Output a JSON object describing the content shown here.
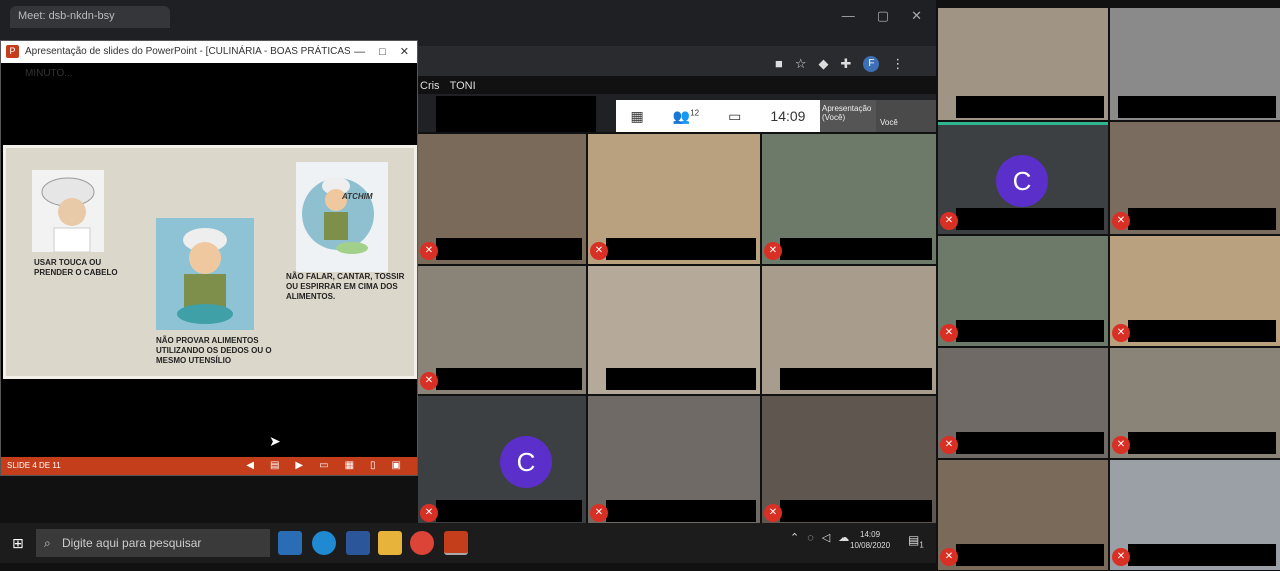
{
  "chrome": {
    "tab_title": "Meet: dsb-nkdn-bsy",
    "window_controls": [
      "—",
      "▢",
      "✕"
    ],
    "bookmarks": [
      "Cris",
      "TONI"
    ],
    "profile": "F"
  },
  "presentation": {
    "title": "Apresentação de slides do PowerPoint - [CULINÁRIA - BOAS PRÁTICAS E PÃO DE MINUTO...",
    "logo": "P",
    "controls": [
      "—",
      "□",
      "✕"
    ],
    "slide": {
      "item1": "USAR TOUCA OU PRENDER O CABELO",
      "item2": "NÃO PROVAR ALIMENTOS UTILIZANDO OS DEDOS OU O MESMO UTENSÍLIO",
      "item3": "NÃO FALAR, CANTAR, TOSSIR OU ESPIRRAR EM CIMA DOS ALIMENTOS.",
      "sneeze": "ATCHIM"
    },
    "status_text": "SLIDE 4 DE 11"
  },
  "meet": {
    "participants_count": "12",
    "time": "14:09",
    "presenting_label": "Apresentação (Você)",
    "you_label": "Você",
    "avatar_letter": "C"
  },
  "taskbar": {
    "search_placeholder": "Digite aqui para pesquisar",
    "clock_time": "14:09",
    "clock_date": "10/08/2020",
    "notification_count": "1"
  },
  "colors": {
    "mute_red": "#d93025",
    "avatar_purple": "#5b2fc9",
    "ppt_orange": "#c43e1c"
  }
}
